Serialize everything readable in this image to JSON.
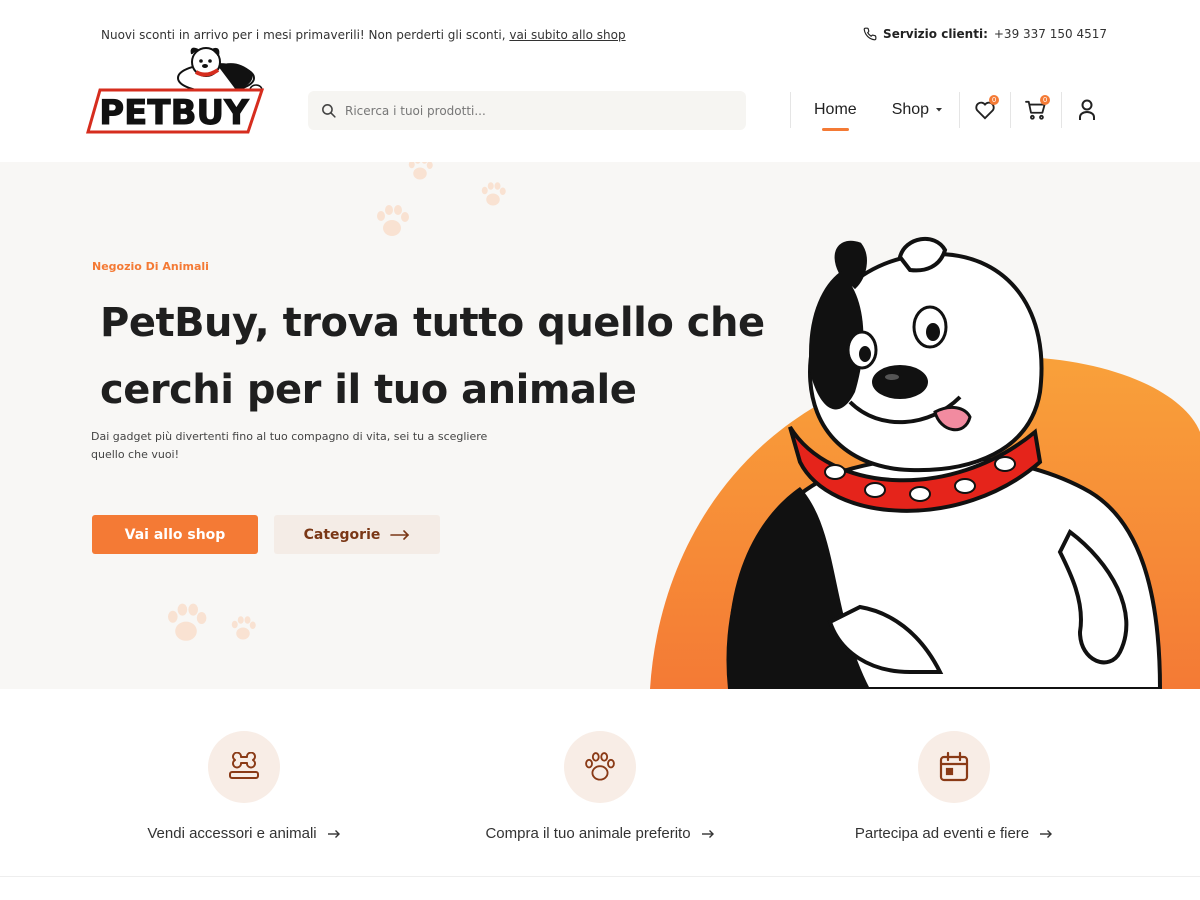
{
  "topbar": {
    "promo_text": "Nuovi sconti in arrivo per i mesi primaverili! Non perderti gli sconti, ",
    "promo_link": "vai subito allo shop",
    "phone_label": "Servizio clienti:",
    "phone_number": "+39 337 150 4517"
  },
  "header": {
    "logo_text": "PETBUY",
    "search_placeholder": "Ricerca i tuoi prodotti...",
    "nav": {
      "home": "Home",
      "shop": "Shop"
    },
    "wishlist_count": "0",
    "cart_count": "0"
  },
  "hero": {
    "eyebrow": "Negozio Di Animali",
    "title_line1": "PetBuy, trova tutto quello che",
    "title_line2": "cerchi per il tuo animale",
    "subtitle": "Dai gadget più divertenti fino al tuo compagno di vita, sei tu a scegliere quello che vuoi!",
    "primary_cta": "Vai allo shop",
    "secondary_cta": "Categorie"
  },
  "features": [
    {
      "label": "Vendi accessori e animali",
      "icon": "bone-icon"
    },
    {
      "label": "Compra il tuo animale preferito",
      "icon": "paw-icon"
    },
    {
      "label": "Partecipa ad eventi e fiere",
      "icon": "calendar-icon"
    }
  ],
  "colors": {
    "accent": "#f47a35",
    "hero_bg": "#f8f7f5",
    "secondary_button_bg": "#f4ece6",
    "secondary_button_text": "#7a3716",
    "icon_circle_bg": "#f8ede6"
  }
}
